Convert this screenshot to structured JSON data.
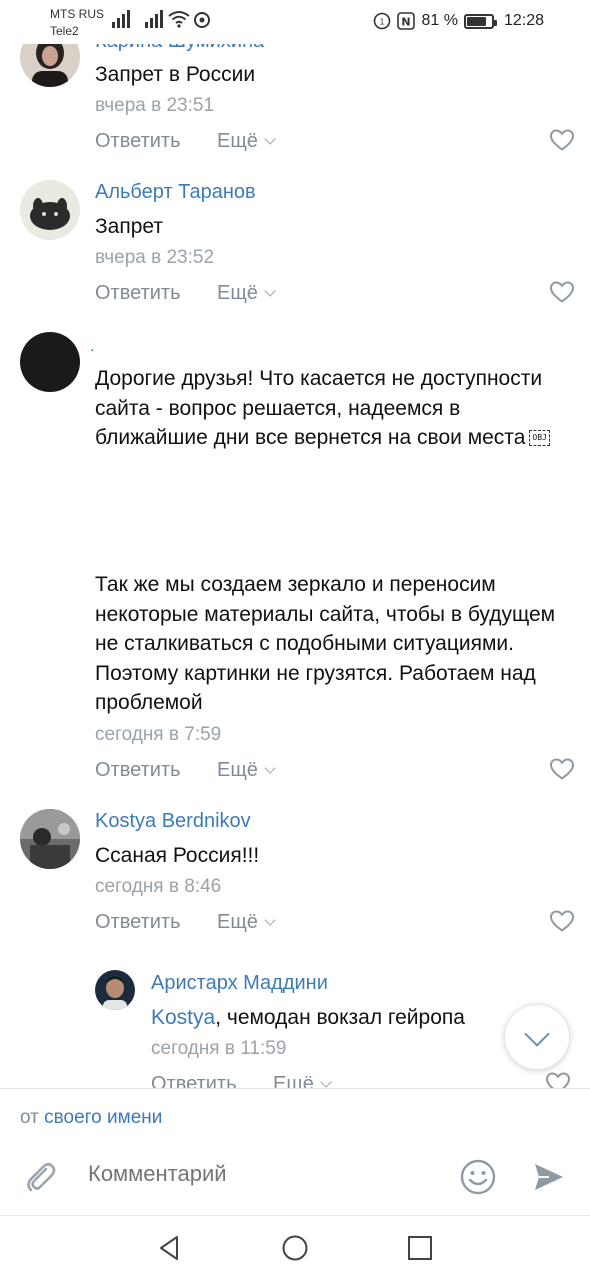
{
  "status_bar": {
    "carrier1": "MTS RUS",
    "carrier2": "Tele2",
    "battery_percent": "81 %",
    "battery_level": 0.81,
    "time": "12:28",
    "icons": [
      "signal-icon",
      "signal-icon",
      "wifi-icon",
      "chrome-icon",
      "vibrate-icon",
      "nfc-icon",
      "battery-icon"
    ]
  },
  "comments": [
    {
      "author": "Карина Шумихина",
      "text": "Запрет в России",
      "time": "вчера в 23:51",
      "reply": "Ответить",
      "more": "Ещё"
    },
    {
      "author": "Альберт Таранов",
      "text": "Запрет",
      "time": "вчера в 23:52",
      "reply": "Ответить",
      "more": "Ещё"
    },
    {
      "author": ".",
      "text1": "Дорогие друзья! Что касается не доступности сайта - вопрос решается, надеемся в ближайшие дни все вернется на свои места",
      "obj": "OBJ",
      "text2": "Так же мы создаем зеркало и переносим некоторые материалы сайта, чтобы в будущем не сталкиваться с подобными ситуациями. Поэтому картинки не грузятся. Работаем над проблемой",
      "time": "сегодня в 7:59",
      "reply": "Ответить",
      "more": "Ещё"
    },
    {
      "author": "Kostya Berdnikov",
      "text": "Ссаная Россия!!!",
      "time": "сегодня в 8:46",
      "reply": "Ответить",
      "more": "Ещё"
    },
    {
      "author": "Аристарх Маддини",
      "mention": "Kostya",
      "text": ", чемодан вокзал гейропа",
      "time": "сегодня в 11:59",
      "reply": "Ответить",
      "more": "Ещё"
    }
  ],
  "composer": {
    "from_prefix": "от",
    "from_link": "своего имени",
    "placeholder": "Комментарий"
  },
  "colors": {
    "link": "#3f7ab8",
    "muted": "#818b96",
    "time": "#9aa2ab"
  }
}
